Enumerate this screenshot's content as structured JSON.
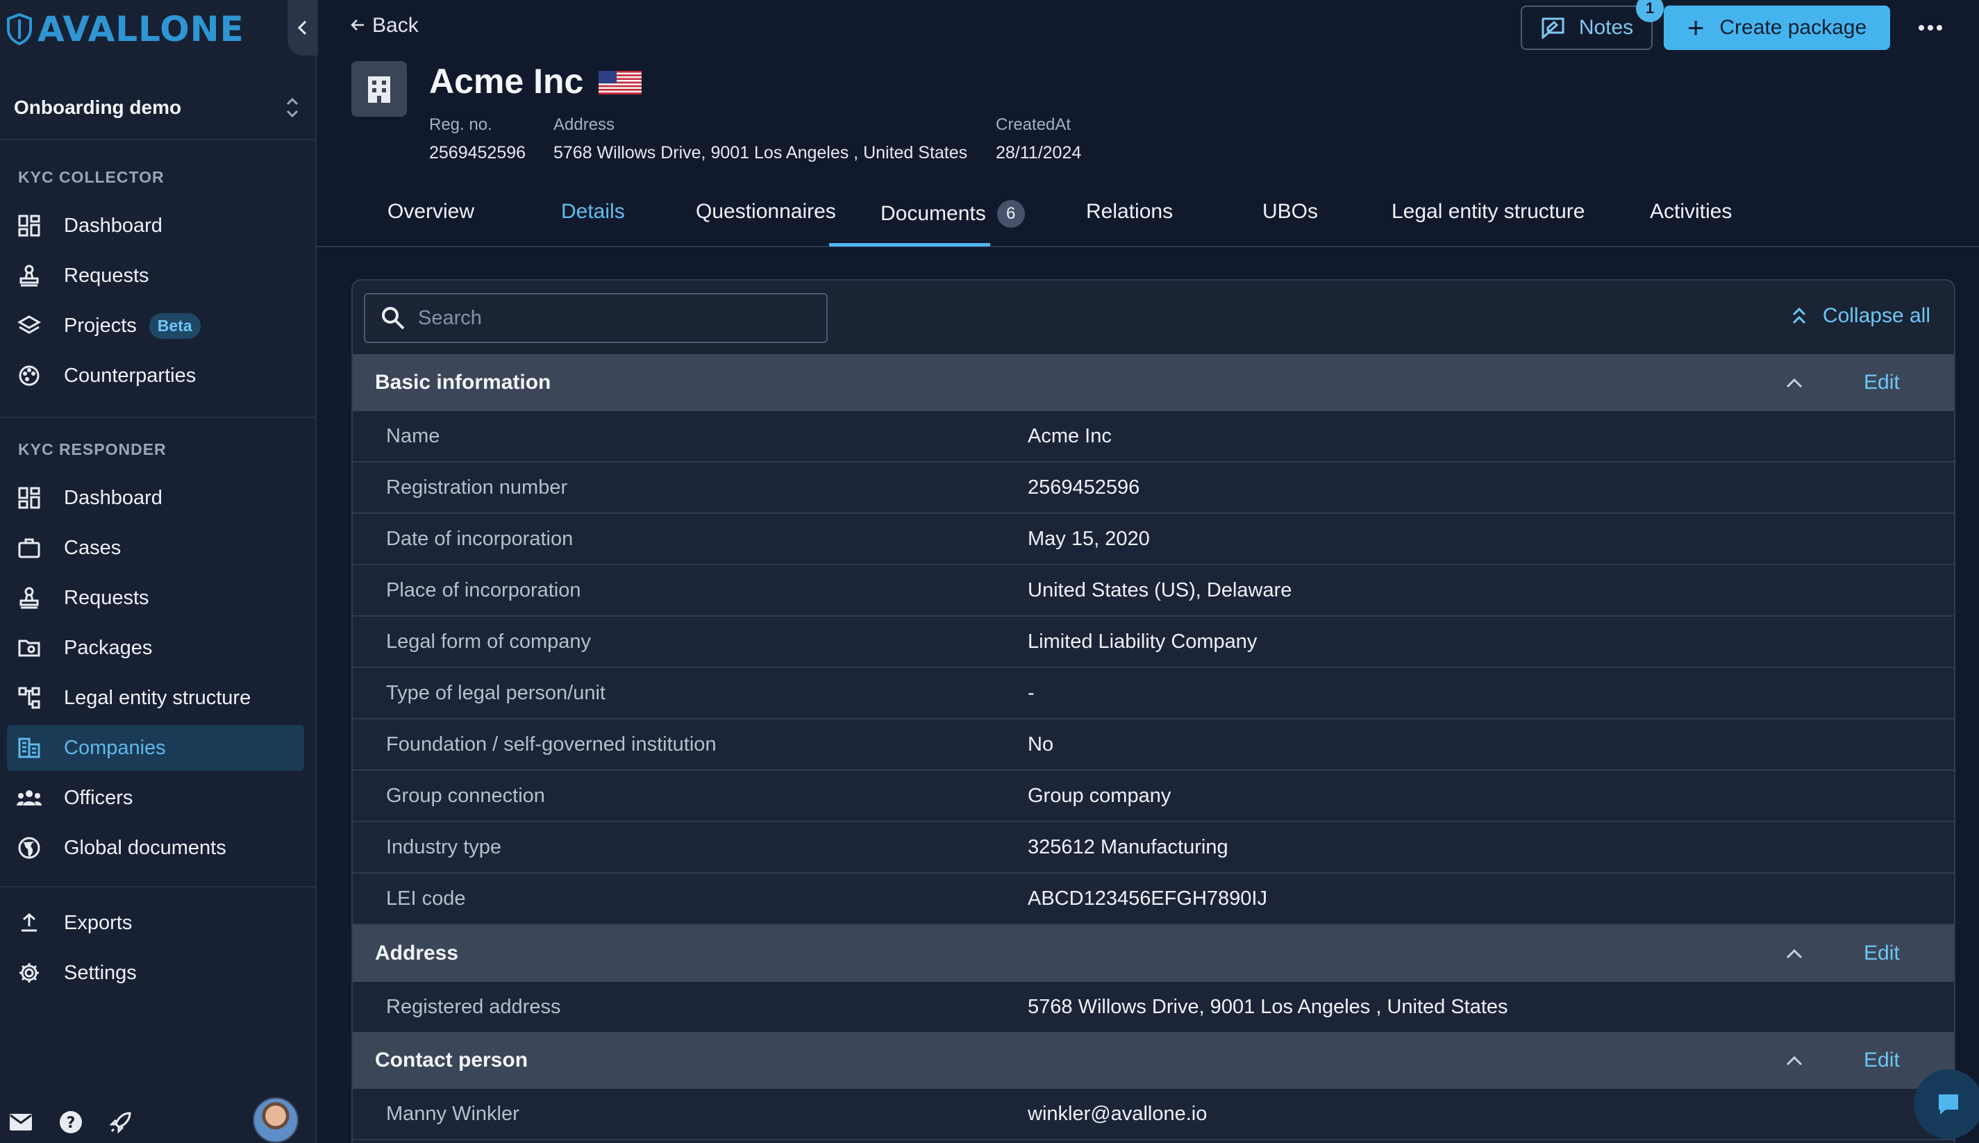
{
  "brand": {
    "name": "AVALLONE",
    "accent": "#45b4ee"
  },
  "workspace": {
    "name": "Onboarding demo"
  },
  "sidebar": {
    "collector_title": "KYC COLLECTOR",
    "collector_items": [
      {
        "label": "Dashboard",
        "icon": "dashboard-icon"
      },
      {
        "label": "Requests",
        "icon": "stamp-icon"
      },
      {
        "label": "Projects",
        "icon": "layers-icon",
        "badge": "Beta"
      },
      {
        "label": "Counterparties",
        "icon": "palette-icon"
      }
    ],
    "responder_title": "KYC RESPONDER",
    "responder_items": [
      {
        "label": "Dashboard",
        "icon": "dashboard-icon"
      },
      {
        "label": "Cases",
        "icon": "briefcase-icon"
      },
      {
        "label": "Requests",
        "icon": "stamp-icon"
      },
      {
        "label": "Packages",
        "icon": "folder-icon"
      },
      {
        "label": "Legal entity structure",
        "icon": "hierarchy-icon"
      },
      {
        "label": "Companies",
        "icon": "building-icon",
        "active": true
      },
      {
        "label": "Officers",
        "icon": "people-icon"
      },
      {
        "label": "Global documents",
        "icon": "globe-icon"
      }
    ],
    "bottom_items": [
      {
        "label": "Exports",
        "icon": "upload-icon"
      },
      {
        "label": "Settings",
        "icon": "gear-icon"
      }
    ]
  },
  "header": {
    "back_label": "Back",
    "notes_label": "Notes",
    "notes_count": "1",
    "create_label": "Create package",
    "company_name": "Acme Inc",
    "meta": [
      {
        "label": "Reg. no.",
        "value": "2569452596"
      },
      {
        "label": "Address",
        "value": "5768 Willows Drive, 9001 Los Angeles , United States"
      },
      {
        "label": "CreatedAt",
        "value": "28/11/2024"
      }
    ]
  },
  "tabs": [
    {
      "label": "Overview"
    },
    {
      "label": "Details",
      "active": true
    },
    {
      "label": "Questionnaires"
    },
    {
      "label": "Documents",
      "badge": "6"
    },
    {
      "label": "Relations"
    },
    {
      "label": "UBOs"
    },
    {
      "label": "Legal entity structure"
    },
    {
      "label": "Activities"
    }
  ],
  "details": {
    "search_placeholder": "Search",
    "collapse_all_label": "Collapse all",
    "edit_label": "Edit",
    "sections": [
      {
        "title": "Basic information",
        "rows": [
          {
            "key": "Name",
            "value": "Acme Inc"
          },
          {
            "key": "Registration number",
            "value": "2569452596"
          },
          {
            "key": "Date of incorporation",
            "value": "May 15, 2020"
          },
          {
            "key": "Place of incorporation",
            "value": "United States (US), Delaware"
          },
          {
            "key": "Legal form of company",
            "value": "Limited Liability Company"
          },
          {
            "key": "Type of legal person/unit",
            "value": "-"
          },
          {
            "key": "Foundation / self-governed institution",
            "value": "No"
          },
          {
            "key": "Group connection",
            "value": "Group company"
          },
          {
            "key": "Industry type",
            "value": "325612 Manufacturing"
          },
          {
            "key": "LEI code",
            "value": "ABCD123456EFGH7890IJ"
          }
        ]
      },
      {
        "title": "Address",
        "rows": [
          {
            "key": "Registered address",
            "value": "5768 Willows Drive, 9001 Los Angeles , United States"
          }
        ]
      },
      {
        "title": "Contact person",
        "rows": [
          {
            "key": "Manny Winkler",
            "value": "winkler@avallone.io"
          }
        ]
      }
    ]
  }
}
